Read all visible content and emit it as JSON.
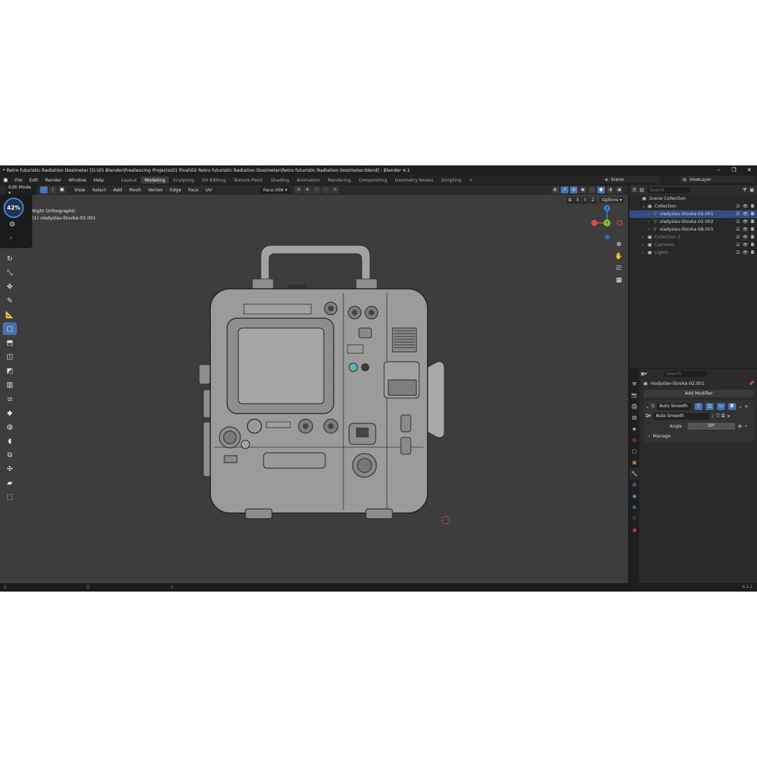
{
  "window": {
    "title": "* Retro futuristic Radiation Dosimeter [D:\\05 Blender\\Freelancing Projects\\01 Final\\02 Retro futuristic Radiation Dosimeter\\Retro futuristic Radiation Dosimeter.blend] - Blender 4.1",
    "controls": [
      "–",
      "❐",
      "✕"
    ]
  },
  "menu": {
    "items": [
      "File",
      "Edit",
      "Render",
      "Window",
      "Help"
    ],
    "workspaces": [
      "Layout",
      "Modeling",
      "Sculpting",
      "UV Editing",
      "Texture Paint",
      "Shading",
      "Animation",
      "Rendering",
      "Compositing",
      "Geometry Nodes",
      "Scripting"
    ],
    "active_workspace": "Modeling",
    "add_tab": "+",
    "scene": "Scene",
    "view_layer": "ViewLayer"
  },
  "viewport_header": {
    "mode": "Edit Mode",
    "menus": [
      "View",
      "Select",
      "Add",
      "Mesh",
      "Vertex",
      "Edge",
      "Face",
      "UV"
    ],
    "transform_orientation": "Face.006",
    "options": "Options",
    "axes": [
      "X",
      "Y",
      "Z"
    ]
  },
  "viewport": {
    "view_name": "Right Orthographic",
    "object_name": "(1) vladyslav-litovka-02.001",
    "gauge_percent": "42%",
    "gizmo_axes": [
      "X",
      "Y",
      "Z"
    ]
  },
  "outliner": {
    "search_placeholder": "Search",
    "rows": [
      {
        "label": "Scene Collection",
        "level": 0
      },
      {
        "label": "Collection",
        "level": 1
      },
      {
        "label": "vladyslav-litovka-02.001",
        "level": 2,
        "selected": true
      },
      {
        "label": "vladyslav-litovka-02.002",
        "level": 2
      },
      {
        "label": "vladyslav-litovka-08.001",
        "level": 2
      },
      {
        "label": "Collection 2",
        "level": 1,
        "dim": true
      },
      {
        "label": "Cameras",
        "level": 1,
        "dim": true
      },
      {
        "label": "Lights",
        "level": 1,
        "dim": true
      }
    ]
  },
  "properties": {
    "search_placeholder": "Search",
    "object_name": "vladyslav-litovka-02.001",
    "add_modifier": "Add Modifier",
    "modifier_name": "Auto Smooth",
    "node_group": "Auto Smooth",
    "node_group_users": "2",
    "angle_label": "Angle",
    "angle_value": "30°",
    "manage_label": "Manage"
  },
  "status": {
    "version": "4.1.1"
  },
  "colors": {
    "accent": "#4772b3",
    "selection": "#334d80",
    "viewport_bg": "#3d3d3d",
    "gizmo_x": "#e04a4a",
    "gizmo_y": "#7ec81c",
    "gizmo_z": "#3e7ee0"
  }
}
